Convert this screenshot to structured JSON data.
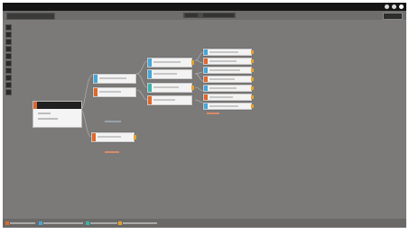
{
  "app": {
    "name": "",
    "menu": [
      "",
      "",
      "",
      "",
      "",
      ""
    ],
    "right_label": ""
  },
  "toolbar": {
    "map_select": "",
    "center_left": "",
    "center_right": "",
    "right_button": ""
  },
  "root": {
    "title": "",
    "lines": [
      "",
      ""
    ]
  },
  "colors": {
    "orange": "#e0672b",
    "blue": "#47a6d8",
    "teal": "#3bb3a8",
    "connector": "#e3a32d"
  },
  "legend": [
    "",
    "",
    "",
    ""
  ]
}
